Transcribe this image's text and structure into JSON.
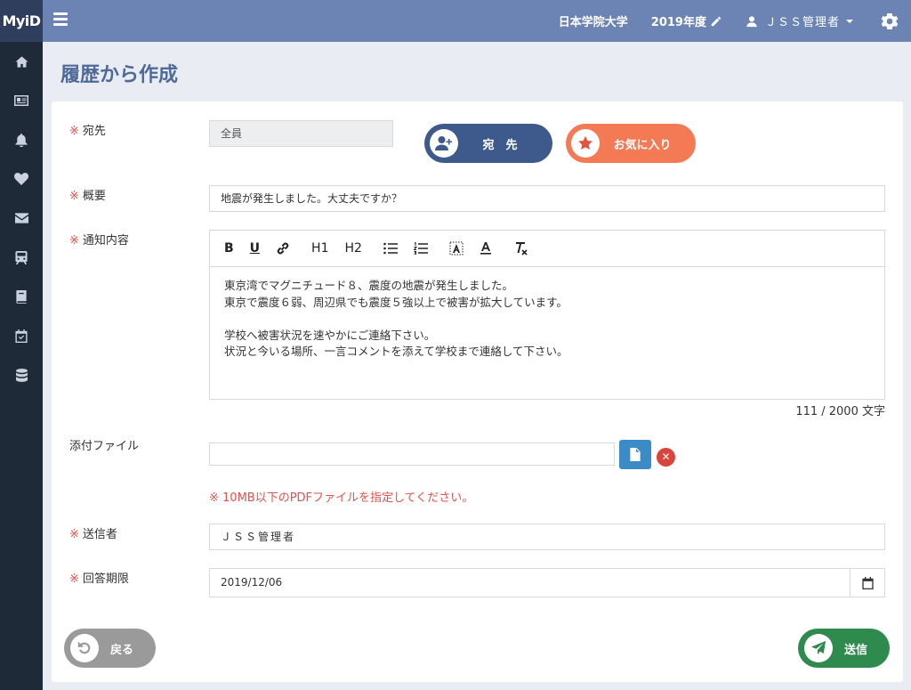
{
  "app": {
    "brand": "MyiD"
  },
  "header": {
    "university": "日本学院大学",
    "year": "2019年度",
    "user": "ＪＳＳ管理者"
  },
  "sidebar": {
    "items": [
      {
        "icon": "home-icon"
      },
      {
        "icon": "id-card-icon"
      },
      {
        "icon": "bell-icon"
      },
      {
        "icon": "heartbeat-icon"
      },
      {
        "icon": "envelope-icon"
      },
      {
        "icon": "train-icon"
      },
      {
        "icon": "book-icon"
      },
      {
        "icon": "calendar-check-icon"
      },
      {
        "icon": "database-icon"
      }
    ]
  },
  "page": {
    "title": "履歴から作成"
  },
  "form": {
    "required_mark": "※",
    "recipient": {
      "label": "宛先",
      "value": "全員"
    },
    "buttons": {
      "recipient": "宛　先",
      "favorites": "お気に入り"
    },
    "summary": {
      "label": "概要",
      "value": "地震が発生しました。大丈夫ですか？"
    },
    "content": {
      "label": "通知内容",
      "toolbar": [
        "B",
        "U",
        "H1",
        "H2"
      ],
      "lines": [
        "東京湾でマグニチュード８、震度の地震が発生しました。",
        "東京で震度６弱、周辺県でも震度５強以上で被害が拡大しています。",
        "",
        "学校へ被害状況を速やかにご連絡下さい。",
        "状況と今いる場所、一言コメントを添えて学校まで連絡して下さい。"
      ],
      "counter": "111 / 2000 文字"
    },
    "attachment": {
      "label": "添付ファイル",
      "note": "※ 10MB以下のPDFファイルを指定してください。"
    },
    "sender": {
      "label": "送信者",
      "value": "ＪＳＳ管理者"
    },
    "deadline": {
      "label": "回答期限",
      "value": "2019/12/06"
    }
  },
  "footer": {
    "back": "戻る",
    "send": "送信"
  },
  "colors": {
    "header": "#6b84b3",
    "sidebar": "#1f2a38",
    "recipient_button": "#3e5a8c",
    "favorites_button": "#f47a55",
    "back_button": "#9a9a9a",
    "send_button": "#2f8a4e",
    "required": "#e0534e"
  }
}
